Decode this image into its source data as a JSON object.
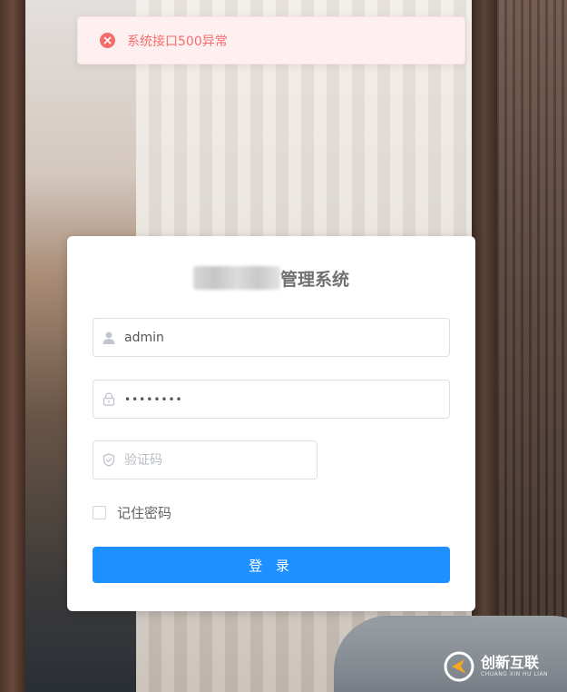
{
  "toast": {
    "type": "error",
    "icon": "error-circle-icon",
    "message": "系统接口500异常"
  },
  "login": {
    "title_suffix": "管理系统",
    "username": {
      "value": "admin",
      "icon": "user-icon"
    },
    "password": {
      "value": "••••••••",
      "icon": "lock-icon"
    },
    "captcha": {
      "placeholder": "验证码",
      "icon": "shield-icon"
    },
    "remember_label": "记住密码",
    "submit_label": "登 录"
  },
  "watermark": {
    "main": "创新互联",
    "sub": "CHUANG XIN HU LIAN"
  },
  "colors": {
    "primary": "#1e90ff",
    "error": "#f56c6c",
    "error_bg": "#fef0f0"
  }
}
